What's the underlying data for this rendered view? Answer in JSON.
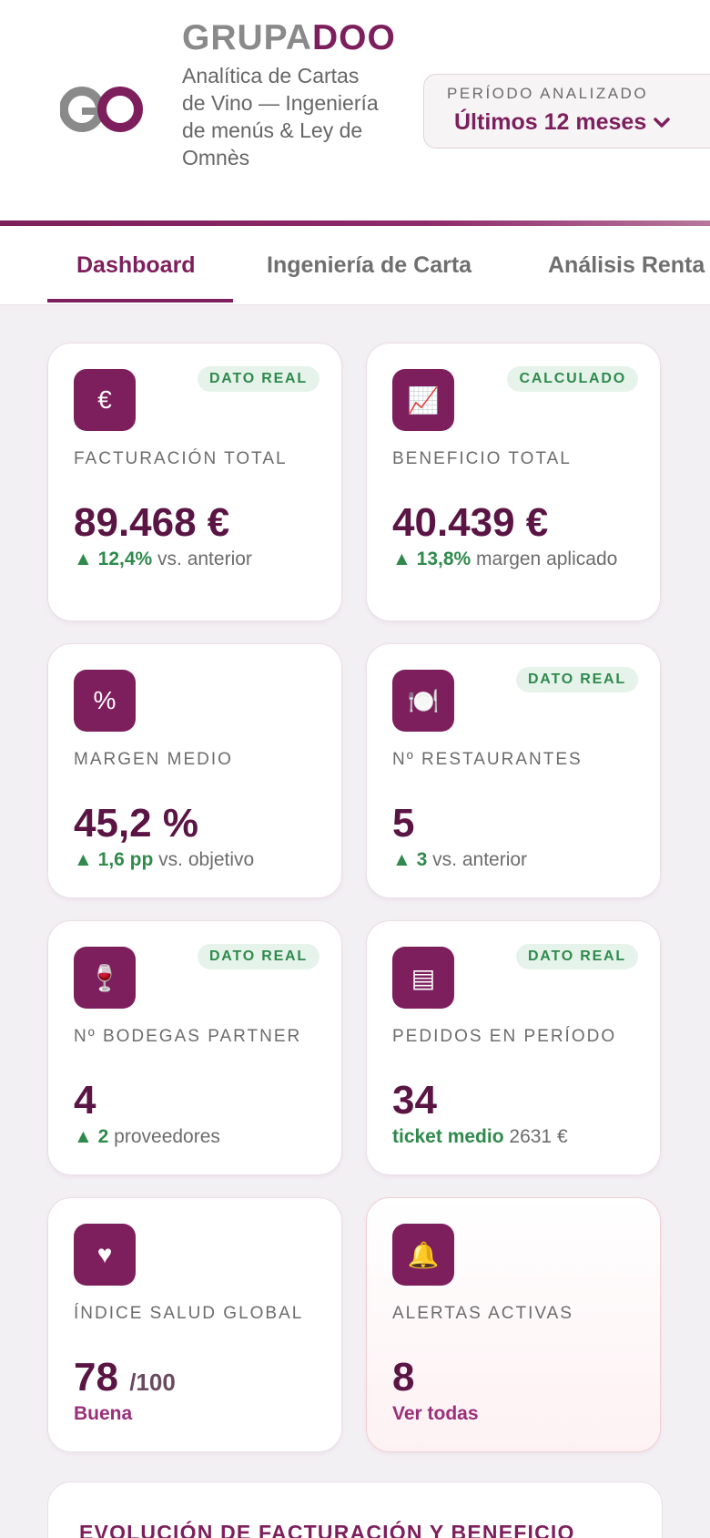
{
  "brand": {
    "title_part1": "GRUPA",
    "title_part2": "DOO",
    "subtitle": "Analítica de Cartas de Vino — Ingeniería de menús & Ley de Omnès",
    "logo_text": "GO"
  },
  "period": {
    "label": "PERÍODO ANALIZADO",
    "value": "Últimos 12 meses"
  },
  "tabs": [
    {
      "label": "Dashboard",
      "active": true
    },
    {
      "label": "Ingeniería de Carta",
      "active": false
    },
    {
      "label": "Análisis Renta",
      "active": false
    }
  ],
  "cards": [
    {
      "icon": "euro-icon",
      "icon_glyph": "€",
      "badge": "DATO REAL",
      "label": "FACTURACIÓN TOTAL",
      "value": "89.468 €",
      "unit": "",
      "trend_arrow": "▲",
      "trend_value": "12,4%",
      "trend_text": "vs. anterior"
    },
    {
      "icon": "chart-trend-icon",
      "icon_glyph": "📈",
      "badge": "CALCULADO",
      "label": "BENEFICIO TOTAL",
      "value": "40.439 €",
      "unit": "",
      "trend_arrow": "▲",
      "trend_value": "13,8%",
      "trend_text": "margen aplicado"
    },
    {
      "icon": "percent-icon",
      "icon_glyph": "%",
      "badge": "",
      "label": "MARGEN MEDIO",
      "value": "45,2 %",
      "unit": "",
      "trend_arrow": "▲",
      "trend_value": "1,6 pp",
      "trend_text": "vs. objetivo"
    },
    {
      "icon": "plate-icon",
      "icon_glyph": "🍽️",
      "badge": "DATO REAL",
      "label": "Nº RESTAURANTES",
      "value": "5",
      "unit": "",
      "trend_arrow": "▲",
      "trend_value": "3",
      "trend_text": "vs. anterior"
    },
    {
      "icon": "wine-glass-icon",
      "icon_glyph": "🍷",
      "badge": "DATO REAL",
      "label": "Nº BODEGAS PARTNER",
      "value": "4",
      "unit": "",
      "trend_arrow": "▲",
      "trend_value": "2",
      "trend_text": "proveedores"
    },
    {
      "icon": "orders-icon",
      "icon_glyph": "▤",
      "badge": "DATO REAL",
      "label": "PEDIDOS EN PERÍODO",
      "value": "34",
      "unit": "",
      "trend_arrow": "",
      "trend_value": "ticket medio",
      "trend_text": "2631 €"
    },
    {
      "icon": "heart-icon",
      "icon_glyph": "♥",
      "badge": "",
      "label": "ÍNDICE SALUD GLOBAL",
      "value": "78",
      "unit": "/100",
      "trend_arrow": "",
      "trend_value": "Buena",
      "trend_text": ""
    },
    {
      "icon": "bell-icon",
      "icon_glyph": "🔔",
      "badge": "",
      "label": "ALERTAS ACTIVAS",
      "value": "8",
      "unit": "",
      "trend_arrow": "",
      "trend_value": "Ver todas",
      "trend_text": ""
    }
  ],
  "section": {
    "title": "EVOLUCIÓN DE FACTURACIÓN Y BENEFICIO"
  },
  "colors": {
    "brand": "#7d1f5c",
    "value": "#5a1544",
    "positive": "#2f8a4c",
    "badge_bg": "#e6f3ea"
  }
}
